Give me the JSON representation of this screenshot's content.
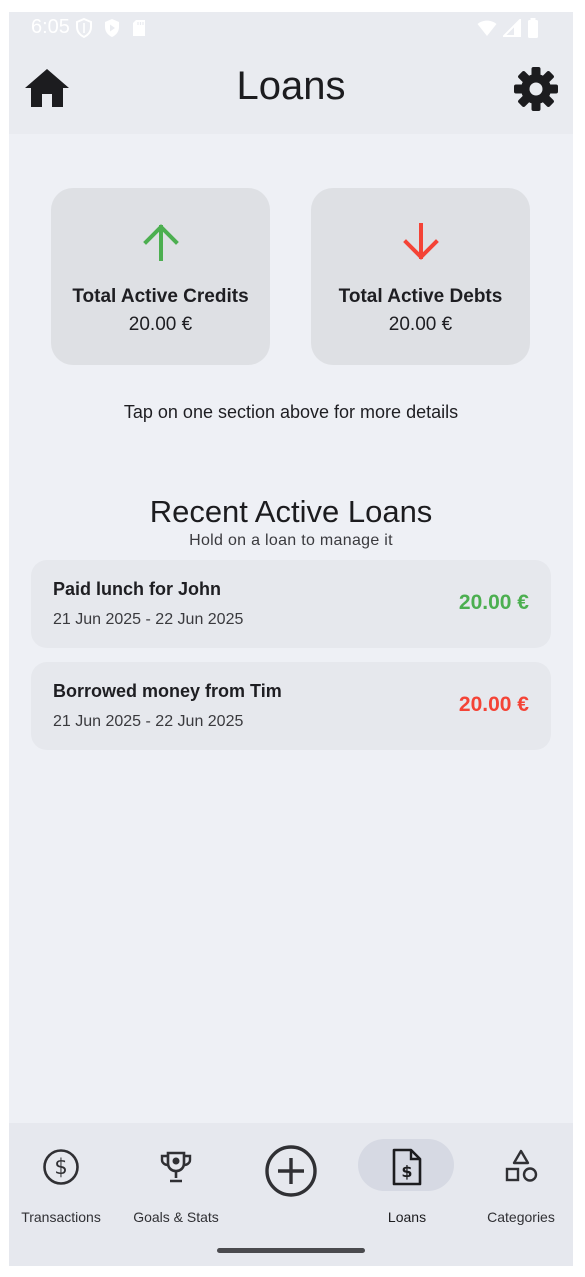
{
  "status_bar": {
    "time": "6:05",
    "left_icons": [
      "shield-icon",
      "play-protect-icon",
      "sd-card-icon"
    ],
    "right_icons": [
      "wifi-icon",
      "cellular-signal-icon",
      "battery-icon"
    ]
  },
  "app_bar": {
    "title": "Loans",
    "left_icon": "home-icon",
    "right_icon": "gear-icon"
  },
  "summary": {
    "credits": {
      "label": "Total Active Credits",
      "value": "20.00 €",
      "icon": "arrow-up-icon",
      "color": "#4caf50"
    },
    "debts": {
      "label": "Total Active Debts",
      "value": "20.00 €",
      "icon": "arrow-down-icon",
      "color": "#f44336"
    }
  },
  "hint": "Tap on one section above for more details",
  "recent": {
    "title": "Recent Active Loans",
    "subtitle": "Hold on a loan to manage it",
    "items": [
      {
        "title": "Paid lunch for John",
        "dates": "21 Jun 2025 - 22 Jun 2025",
        "amount": "20.00 €",
        "type": "credit",
        "color": "#4caf50"
      },
      {
        "title": "Borrowed money from Tim",
        "dates": "21 Jun 2025 - 22 Jun 2025",
        "amount": "20.00 €",
        "type": "debt",
        "color": "#f44336"
      }
    ]
  },
  "bottom_nav": {
    "items": [
      {
        "label": "Transactions",
        "icon": "dollar-circle-icon",
        "selected": false
      },
      {
        "label": "Goals & Stats",
        "icon": "trophy-icon",
        "selected": false
      },
      {
        "label": "",
        "icon": "add-circle-icon",
        "selected": false
      },
      {
        "label": "Loans",
        "icon": "dollar-document-icon",
        "selected": true
      },
      {
        "label": "Categories",
        "icon": "shapes-icon",
        "selected": false
      }
    ]
  }
}
